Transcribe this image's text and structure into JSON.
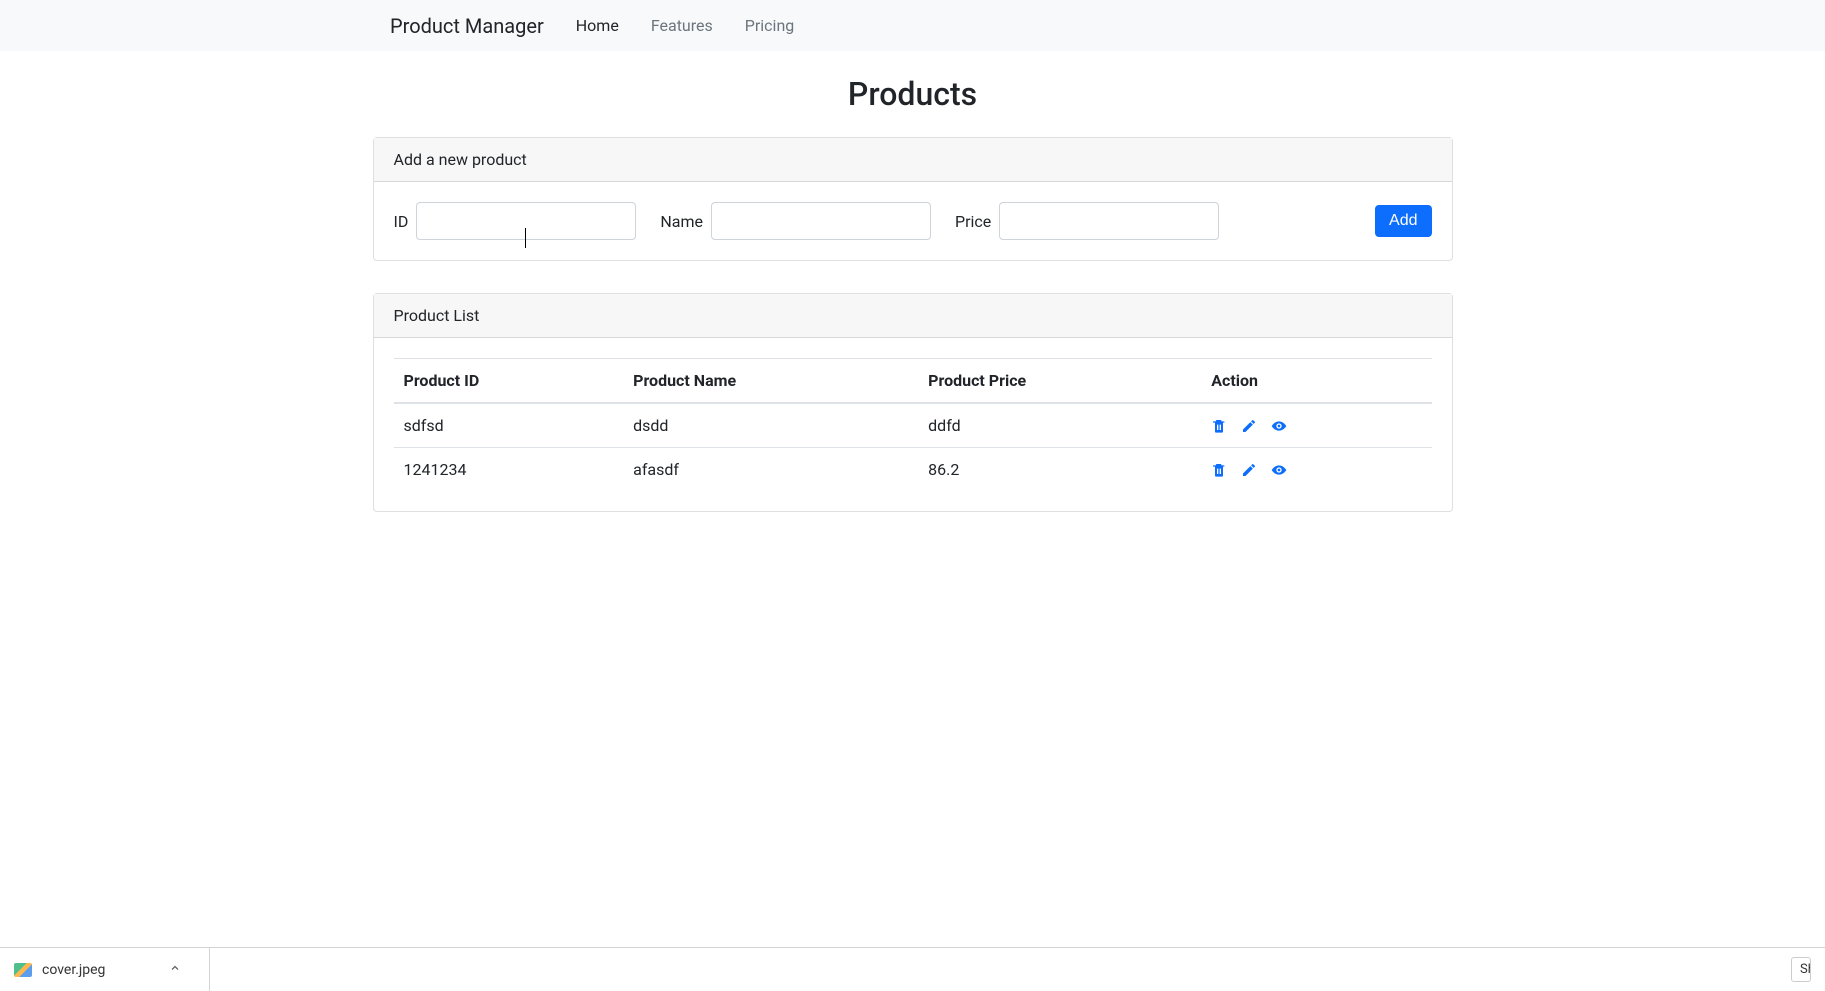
{
  "navbar": {
    "brand": "Product Manager",
    "links": [
      {
        "label": "Home",
        "active": true
      },
      {
        "label": "Features",
        "active": false
      },
      {
        "label": "Pricing",
        "active": false
      }
    ]
  },
  "page_title": "Products",
  "add_form": {
    "header": "Add a new product",
    "id_label": "ID",
    "name_label": "Name",
    "price_label": "Price",
    "id_value": "",
    "name_value": "",
    "price_value": "",
    "submit_label": "Add"
  },
  "list_panel": {
    "header": "Product List",
    "columns": {
      "id": "Product ID",
      "name": "Product Name",
      "price": "Product Price",
      "action": "Action"
    },
    "rows": [
      {
        "id": "sdfsd",
        "name": "dsdd",
        "price": "ddfd"
      },
      {
        "id": "1241234",
        "name": "afasdf",
        "price": "86.2"
      }
    ]
  },
  "downloads": {
    "file": "cover.jpeg",
    "showall": "Sh"
  }
}
